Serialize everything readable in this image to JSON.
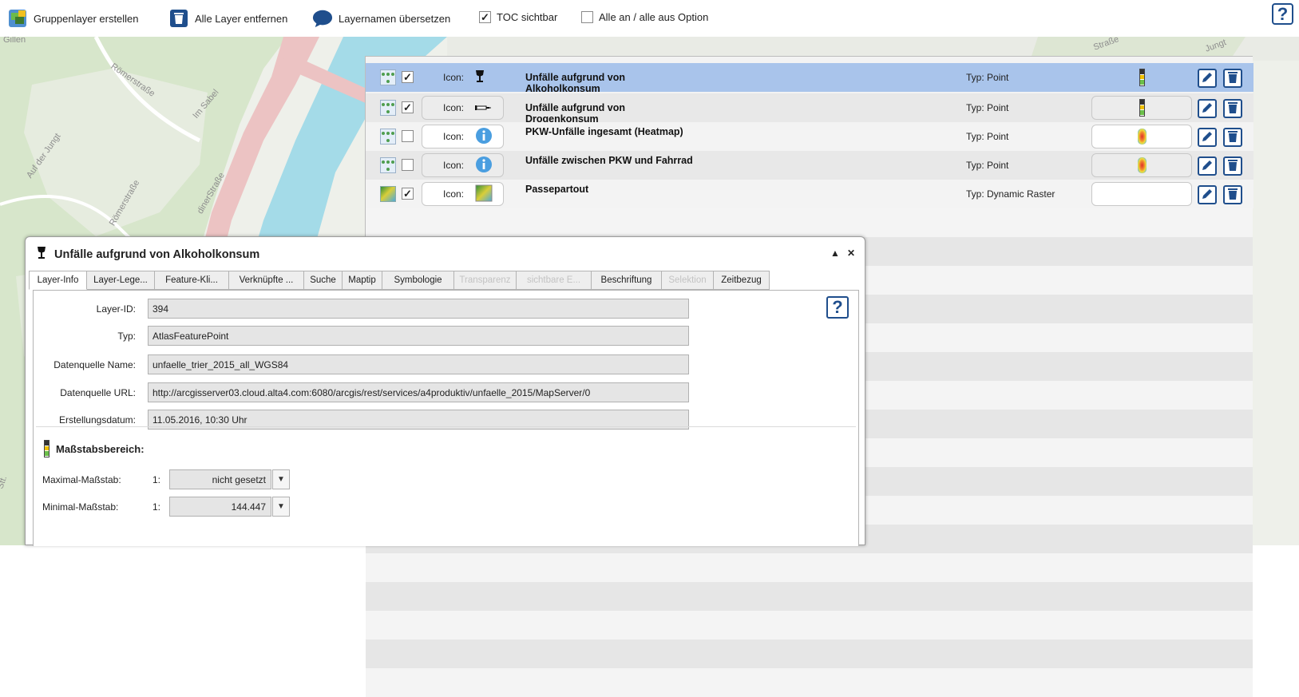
{
  "toolbar": {
    "create_group_label": "Gruppenlayer erstellen",
    "remove_all_label": "Alle Layer entfernen",
    "translate_label": "Layernamen übersetzen",
    "toc_visible_label": "TOC sichtbar",
    "toc_visible_checked": true,
    "all_on_off_label": "Alle an / alle aus Option",
    "all_on_off_checked": false,
    "help_label": "?"
  },
  "map": {
    "labels": [
      "Gillen",
      "Römerstraße",
      "Auf der Jungt",
      "Im Sabel",
      "Römerstraße",
      "dinerStraße",
      "Straße",
      "Jungt",
      "Stt."
    ]
  },
  "layers": [
    {
      "title": "Unfälle aufgrund von Alkoholkonsum",
      "icon_label": "Icon:",
      "icon": "goblet-icon",
      "type": "Typ: Point",
      "scale": "scalebar",
      "checked": true,
      "selected": true
    },
    {
      "title": "Unfälle aufgrund von Drogenkonsum",
      "icon_label": "Icon:",
      "icon": "syringe-icon",
      "type": "Typ: Point",
      "scale": "scalebar",
      "checked": true,
      "selected": false
    },
    {
      "title": "PKW-Unfälle ingesamt (Heatmap)",
      "icon_label": "Icon:",
      "icon": "info-icon",
      "type": "Typ: Point",
      "scale": "heatmap",
      "checked": false,
      "selected": false
    },
    {
      "title": "Unfälle zwischen PKW und Fahrrad",
      "icon_label": "Icon:",
      "icon": "info-icon",
      "type": "Typ: Point",
      "scale": "heatmap",
      "checked": false,
      "selected": false
    },
    {
      "title": "Passepartout",
      "icon_label": "Icon:",
      "icon": "raster-icon",
      "type": "Typ: Dynamic Raster",
      "scale": "",
      "checked": true,
      "selected": false
    }
  ],
  "info_window": {
    "title": "Unfälle aufgrund von Alkoholkonsum",
    "tabs": [
      {
        "label": "Layer-Info",
        "state": "active"
      },
      {
        "label": "Layer-Lege...",
        "state": "normal"
      },
      {
        "label": "Feature-Kli...",
        "state": "normal"
      },
      {
        "label": "Verknüpfte ...",
        "state": "normal"
      },
      {
        "label": "Suche",
        "state": "normal"
      },
      {
        "label": "Maptip",
        "state": "normal"
      },
      {
        "label": "Symbologie",
        "state": "normal"
      },
      {
        "label": "Transparenz",
        "state": "disabled"
      },
      {
        "label": "sichtbare E...",
        "state": "disabled"
      },
      {
        "label": "Beschriftung",
        "state": "normal"
      },
      {
        "label": "Selektion",
        "state": "disabled"
      },
      {
        "label": "Zeitbezug",
        "state": "normal"
      }
    ],
    "fields": [
      {
        "label": "Layer-ID:",
        "value": "394"
      },
      {
        "label": "Typ:",
        "value": "AtlasFeaturePoint"
      },
      {
        "label": "Datenquelle Name:",
        "value": "unfaelle_trier_2015_all_WGS84"
      },
      {
        "label": "Datenquelle URL:",
        "value": "http://arcgisserver03.cloud.alta4.com:6080/arcgis/rest/services/a4produktiv/unfaelle_2015/MapServer/0"
      },
      {
        "label": "Erstellungsdatum:",
        "value": "11.05.2016, 10:30 Uhr"
      }
    ],
    "help_label": "?",
    "scale_section": {
      "heading": "Maßstabsbereich:",
      "max_label": "Maximal-Maßstab:",
      "max_prefix": "1:",
      "max_value": "nicht gesetzt",
      "min_label": "Minimal-Maßstab:",
      "min_prefix": "1:",
      "min_value": "144.447"
    }
  },
  "colors": {
    "accent": "#1f4e8c",
    "selected_row": "#a9c4eb",
    "river": "#a4dbe8",
    "road": "#ecc3c3"
  }
}
